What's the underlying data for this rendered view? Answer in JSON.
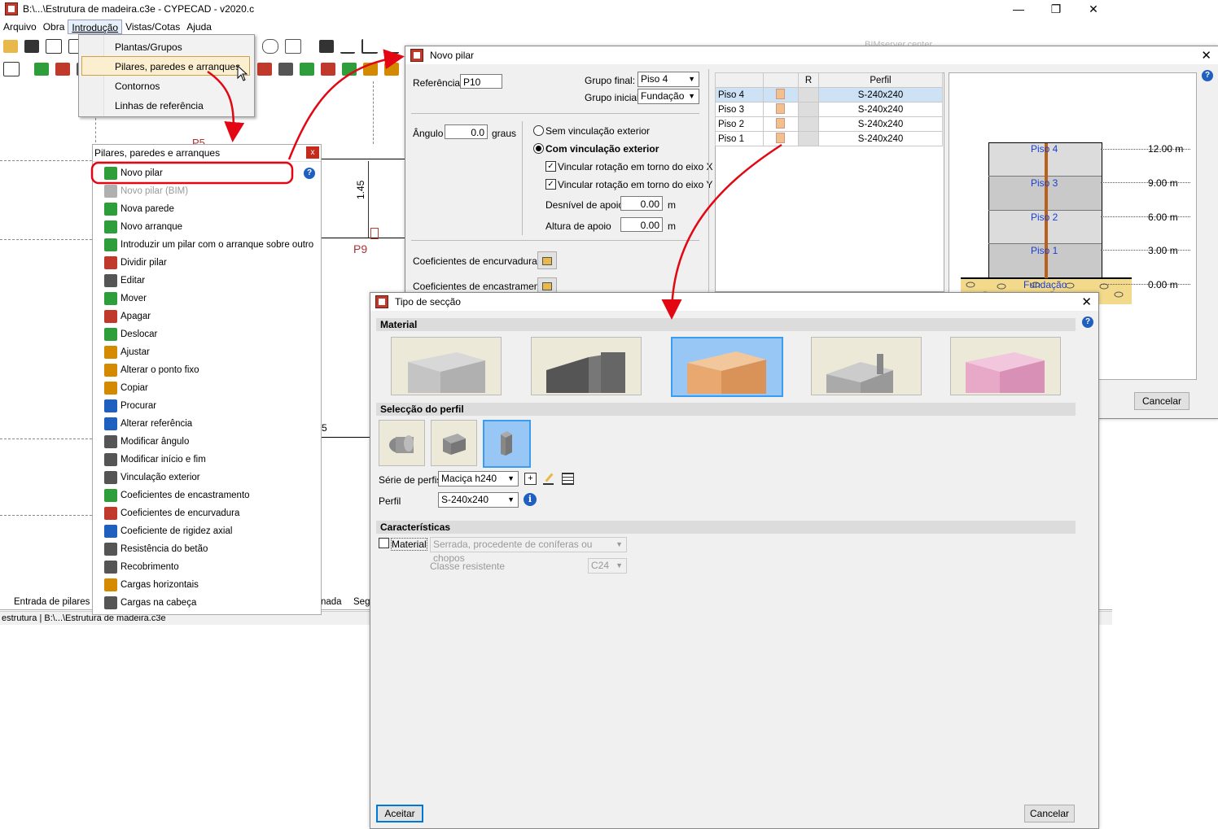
{
  "window": {
    "title": "B:\\...\\Estrutura de madeira.c3e - CYPECAD - v2020.c"
  },
  "menubar": [
    "Arquivo",
    "Obra",
    "Introdução",
    "Vistas/Cotas",
    "Ajuda"
  ],
  "dropdown": {
    "items": [
      "Plantas/Grupos",
      "Pilares, paredes e arranques",
      "Contornos",
      "Linhas de referência"
    ]
  },
  "canvas": {
    "dim_label": "1.45",
    "pillar_label": "P9",
    "label_p5": "P5",
    "label_5": "5"
  },
  "sidepanel": {
    "title": "Pilares, paredes e arranques",
    "close": "x",
    "items": [
      {
        "label": "Novo pilar",
        "icon": "new-pillar-icon",
        "color": "#2e9e3a"
      },
      {
        "label": "Novo pilar (BIM)",
        "icon": "new-pillar-bim-icon",
        "color": "#b0b0b0",
        "disabled": true
      },
      {
        "label": "Nova parede",
        "icon": "new-wall-icon",
        "color": "#2e9e3a"
      },
      {
        "label": "Novo arranque",
        "icon": "new-start-icon",
        "color": "#2e9e3a"
      },
      {
        "label": "Introduzir um pilar com o arranque sobre outro",
        "icon": "pillar-over-icon",
        "color": "#2e9e3a"
      },
      {
        "label": "Dividir pilar",
        "icon": "split-pillar-icon",
        "color": "#c0392b"
      },
      {
        "label": "Editar",
        "icon": "edit-icon",
        "color": "#555"
      },
      {
        "label": "Mover",
        "icon": "move-icon",
        "color": "#2e9e3a"
      },
      {
        "label": "Apagar",
        "icon": "delete-icon",
        "color": "#c0392b"
      },
      {
        "label": "Deslocar",
        "icon": "shift-icon",
        "color": "#2e9e3a"
      },
      {
        "label": "Ajustar",
        "icon": "adjust-icon",
        "color": "#d48a00"
      },
      {
        "label": "Alterar o ponto fixo",
        "icon": "fixed-point-icon",
        "color": "#d48a00"
      },
      {
        "label": "Copiar",
        "icon": "copy-icon",
        "color": "#d48a00"
      },
      {
        "label": "Procurar",
        "icon": "search-icon",
        "color": "#1f5fbf"
      },
      {
        "label": "Alterar referência",
        "icon": "reference-icon",
        "color": "#1f5fbf"
      },
      {
        "label": "Modificar ângulo",
        "icon": "angle-icon",
        "color": "#555"
      },
      {
        "label": "Modificar início e fim",
        "icon": "start-end-icon",
        "color": "#555"
      },
      {
        "label": "Vinculação exterior",
        "icon": "external-link-icon",
        "color": "#555"
      },
      {
        "label": "Coeficientes de encastramento",
        "icon": "fixity-coef-icon",
        "color": "#2e9e3a"
      },
      {
        "label": "Coeficientes de encurvadura",
        "icon": "buckling-coef-icon",
        "color": "#c0392b"
      },
      {
        "label": "Coeficiente de rigidez axial",
        "icon": "axial-stiffness-icon",
        "color": "#1f5fbf"
      },
      {
        "label": "Resistência do betão",
        "icon": "concrete-strength-icon",
        "color": "#555"
      },
      {
        "label": "Recobrimento",
        "icon": "cover-icon",
        "color": "#555"
      },
      {
        "label": "Cargas horizontais",
        "icon": "horizontal-loads-icon",
        "color": "#d48a00"
      },
      {
        "label": "Cargas na cabeça",
        "icon": "head-loads-icon",
        "color": "#555"
      }
    ]
  },
  "tabs": {
    "entry": "Entrada de pilares",
    "next": "nada",
    "seg": "Seg"
  },
  "statusbar": {
    "text": "estrutura | B:\\...\\Estrutura de madeira.c3e"
  },
  "toolbar_right": {
    "bim_text": "BIMserver.center"
  },
  "novo_pilar": {
    "title": "Novo pilar",
    "referencia_label": "Referência",
    "referencia_value": "P10",
    "grupo_final_label": "Grupo final:",
    "grupo_final_value": "Piso 4",
    "grupo_inicial_label": "Grupo inicial:",
    "grupo_inicial_value": "Fundação",
    "angulo_label": "Ângulo",
    "angulo_value": "0.0",
    "graus": "graus",
    "sem_vinc": "Sem vinculação exterior",
    "com_vinc": "Com vinculação exterior",
    "vinc_x": "Vincular rotação em torno do eixo X",
    "vinc_y": "Vincular rotação em torno do eixo Y",
    "desnivel_label": "Desnível de apoio",
    "desnivel_value": "0.00",
    "altura_label": "Altura de apoio",
    "altura_value": "0.00",
    "unit_m": "m",
    "coef_encurvadura": "Coeficientes de encurvadura",
    "coef_encastramento": "Coeficientes de encastramento",
    "table_headers": [
      "",
      "",
      "R",
      "Perfil"
    ],
    "table_rows": [
      {
        "piso": "Piso 4",
        "perfil": "S-240x240"
      },
      {
        "piso": "Piso 3",
        "perfil": "S-240x240"
      },
      {
        "piso": "Piso 2",
        "perfil": "S-240x240"
      },
      {
        "piso": "Piso 1",
        "perfil": "S-240x240"
      }
    ],
    "elev_floors": [
      "Piso 4",
      "Piso 3",
      "Piso 2",
      "Piso 1",
      "Fundação"
    ],
    "elev_levels": [
      "12.00 m",
      "9.00 m",
      "6.00 m",
      "3.00 m",
      "0.00 m"
    ],
    "cancel": "Cancelar"
  },
  "tipo_seccao": {
    "title": "Tipo de secção",
    "material_hdr": "Material",
    "selec_hdr": "Selecção do perfil",
    "serie_label": "Série de perfis",
    "serie_value": "Maciça h240",
    "perfil_label": "Perfil",
    "perfil_value": "S-240x240",
    "carac_hdr": "Características",
    "material_chk": "Material",
    "material_value": "Serrada, procedente de coníferas ou chopos",
    "classe_label": "Classe resistente",
    "classe_value": "C24",
    "ok": "Aceitar",
    "cancel": "Cancelar"
  },
  "colors": {
    "accent": "#0078d7",
    "arrow": "#e30613",
    "wood": "#e8a870",
    "selected": "#99c7f5"
  }
}
